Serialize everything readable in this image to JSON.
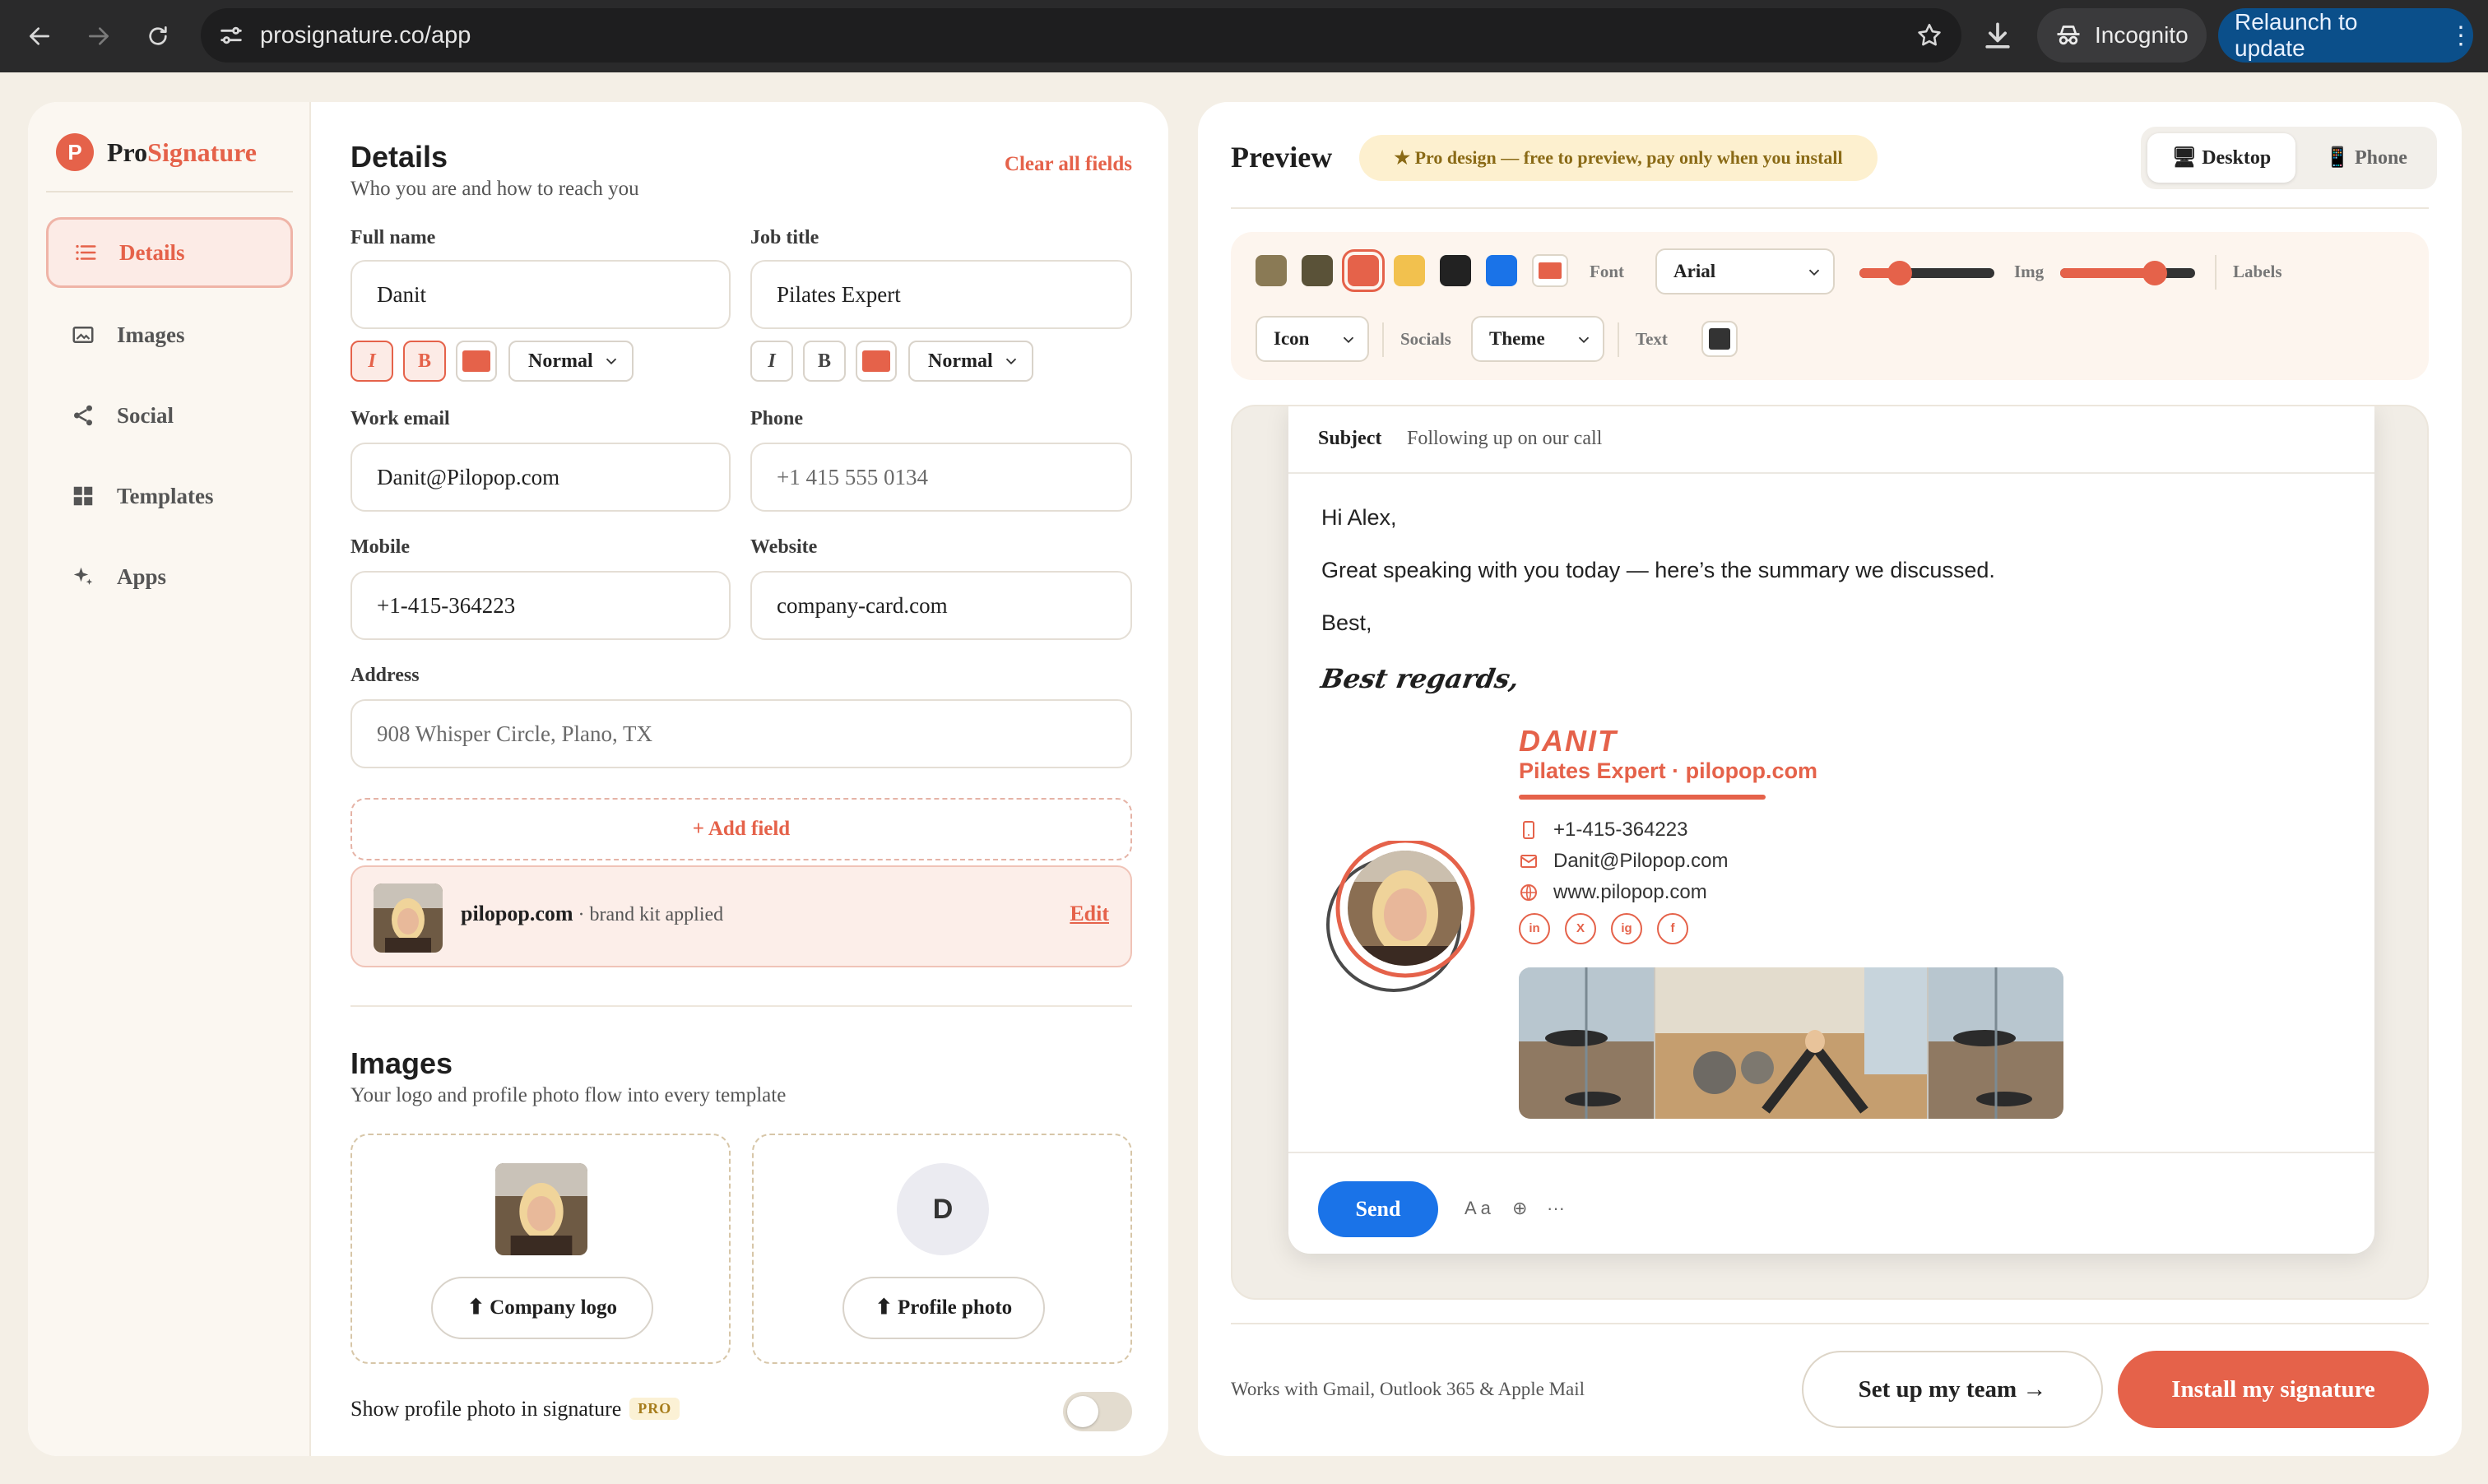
{
  "browser": {
    "url": "prosignature.co/app",
    "incognito_label": "Incognito",
    "relaunch_label": "Relaunch to update",
    "relaunch_more": "⋮"
  },
  "brand": {
    "badge": "P",
    "name_part1": "Pro",
    "name_part2": "Signature",
    "accent_color": "#e5624a"
  },
  "sidebar": {
    "items": [
      {
        "label": "Details",
        "icon": "list-icon",
        "active": true
      },
      {
        "label": "Images",
        "icon": "image-icon",
        "active": false
      },
      {
        "label": "Social",
        "icon": "share-icon",
        "active": false
      },
      {
        "label": "Templates",
        "icon": "grid-icon",
        "active": false
      },
      {
        "label": "Apps",
        "icon": "sparkle-icon",
        "active": false
      }
    ]
  },
  "details": {
    "title": "Details",
    "subtitle": "Who you are and how to reach you",
    "clear_all": "Clear all fields",
    "full_name": {
      "label": "Full name",
      "value": "Danit"
    },
    "job_title": {
      "label": "Job title",
      "value": "Pilates Expert"
    },
    "format_italic": "I",
    "format_bold": "B",
    "format_size": "Normal",
    "work_email": {
      "label": "Work email",
      "value": "Danit@Pilopop.com"
    },
    "phone": {
      "label": "Phone",
      "placeholder": "+1 415 555 0134"
    },
    "mobile": {
      "label": "Mobile",
      "value": "+1-415-364223"
    },
    "website": {
      "label": "Website",
      "value": "company-card.com"
    },
    "address": {
      "label": "Address",
      "placeholder": "908 Whisper Circle, Plano, TX"
    },
    "add_field": "+ Add field",
    "brand_kit": {
      "name": "pilopop.com",
      "note": " · brand kit applied",
      "edit": "Edit"
    }
  },
  "images": {
    "title": "Images",
    "subtitle": "Your logo and profile photo flow into every template",
    "company_logo_button": "⬆ Company logo",
    "profile_photo_initial": "D",
    "profile_photo_button": "⬆ Profile photo",
    "show_photo_label": "Show profile photo in signature",
    "pro_badge": "PRO",
    "show_photo_enabled": false
  },
  "preview": {
    "title": "Preview",
    "pro_pill": "★ Pro design — free to preview, pay only when you install",
    "view_desktop": "Desktop",
    "view_phone": "Phone",
    "swatches": [
      "#8a7a55",
      "#5a5238",
      "#e5624a",
      "#f2c14e",
      "#222222",
      "#1a73e8",
      "#e5624a"
    ],
    "font_label": "Font",
    "font_value": "Arial",
    "img_label": "Img",
    "labels_label": "Labels",
    "icon_select": "Icon",
    "socials_label": "Socials",
    "theme_select": "Theme",
    "text_label": "Text",
    "size_slider": 0.3,
    "img_slider": 0.7
  },
  "email": {
    "subject_label": "Subject",
    "subject_value": "Following up on our call",
    "greeting": "Hi Alex,",
    "body": "Great speaking with you today — here’s the summary we discussed.",
    "closing": "Best,",
    "signoff": "Best regards,",
    "sig_name": "DANIT",
    "sig_title": "Pilates Expert · pilopop.com",
    "sig_phone": "+1-415-364223",
    "sig_email": "Danit@Pilopop.com",
    "sig_web": "www.pilopop.com",
    "socials": [
      "in",
      "X",
      "ig",
      "f"
    ],
    "send": "Send",
    "format_text": "A a",
    "more": "⊕",
    "dots": "···"
  },
  "footer": {
    "works_with": "Works with Gmail, Outlook 365 & Apple Mail",
    "team_button": "Set up my team →",
    "install_button": "Install my signature"
  }
}
